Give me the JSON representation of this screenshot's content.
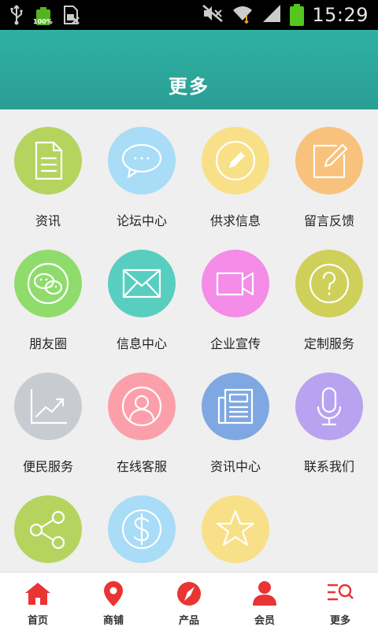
{
  "status_bar": {
    "time": "15:29",
    "battery_small_pct": "100%",
    "icons": [
      "usb-icon",
      "battery-icon",
      "sim-icon",
      "mute-icon",
      "wifi-icon",
      "signal-icon",
      "battery-icon"
    ]
  },
  "header": {
    "title": "更多"
  },
  "grid": {
    "items": [
      {
        "label": "资讯",
        "icon": "document-icon",
        "color": "#b5d45f"
      },
      {
        "label": "论坛中心",
        "icon": "chat-bubble-icon",
        "color": "#a8dcf7"
      },
      {
        "label": "供求信息",
        "icon": "pencil-icon",
        "color": "#f8e088"
      },
      {
        "label": "留言反馈",
        "icon": "edit-icon",
        "color": "#f8c27c"
      },
      {
        "label": "朋友圈",
        "icon": "wechat-icon",
        "color": "#8fdc6c"
      },
      {
        "label": "信息中心",
        "icon": "envelope-icon",
        "color": "#58cec0"
      },
      {
        "label": "企业宣传",
        "icon": "video-camera-icon",
        "color": "#f48ce8"
      },
      {
        "label": "定制服务",
        "icon": "question-icon",
        "color": "#cfd05a"
      },
      {
        "label": "便民服务",
        "icon": "trend-chart-icon",
        "color": "#c8ccd2"
      },
      {
        "label": "在线客服",
        "icon": "user-circle-icon",
        "color": "#fba0aa"
      },
      {
        "label": "资讯中心",
        "icon": "newspaper-icon",
        "color": "#7fa8e2"
      },
      {
        "label": "联系我们",
        "icon": "microphone-icon",
        "color": "#b9a3f0"
      },
      {
        "label": "",
        "icon": "share-icon",
        "color": "#b5d45f"
      },
      {
        "label": "",
        "icon": "dollar-icon",
        "color": "#a8dcf7"
      },
      {
        "label": "",
        "icon": "star-icon",
        "color": "#f8e088"
      }
    ]
  },
  "bottom_nav": {
    "accent": "#e93434",
    "items": [
      {
        "label": "首页",
        "icon": "home-icon"
      },
      {
        "label": "商铺",
        "icon": "location-pin-icon"
      },
      {
        "label": "产品",
        "icon": "compass-icon"
      },
      {
        "label": "会员",
        "icon": "person-icon"
      },
      {
        "label": "更多",
        "icon": "menu-search-icon"
      }
    ]
  }
}
